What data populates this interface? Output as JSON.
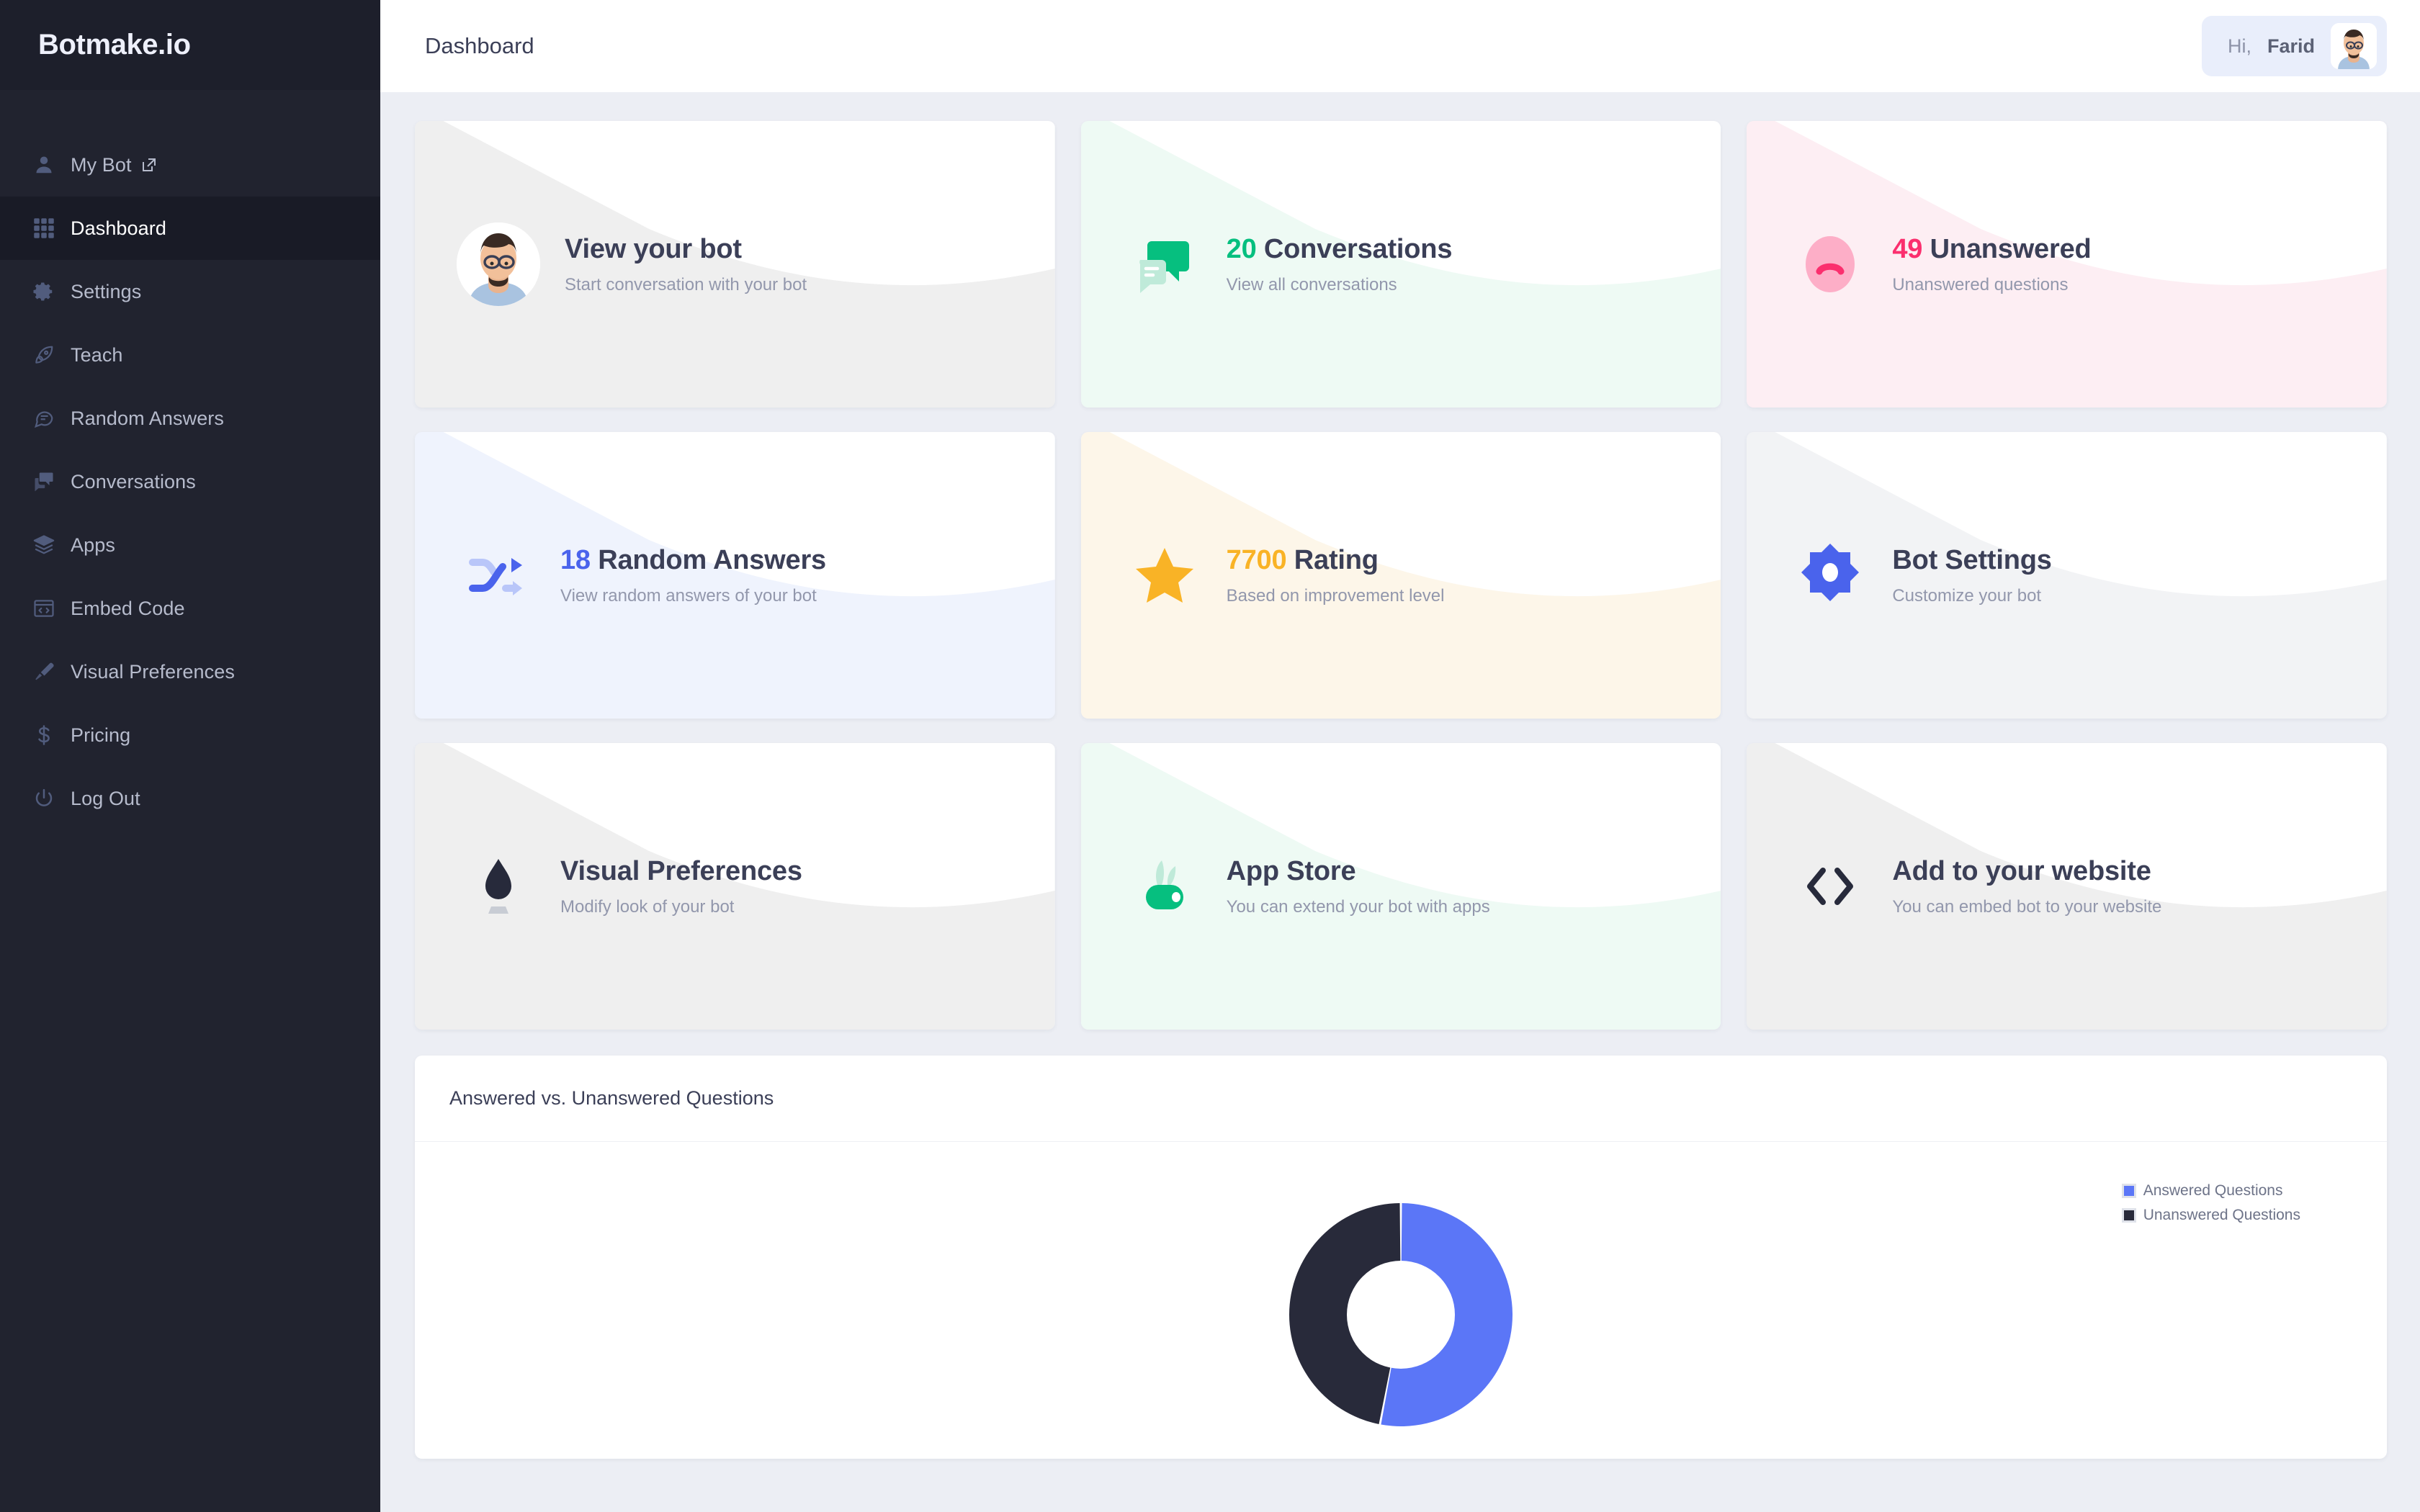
{
  "brand": {
    "name": "Botmake.io"
  },
  "sidebar": {
    "items": [
      {
        "label": "My Bot",
        "icon": "user-icon",
        "external": true,
        "active": false
      },
      {
        "label": "Dashboard",
        "icon": "grid-icon",
        "external": false,
        "active": true
      },
      {
        "label": "Settings",
        "icon": "gear-icon",
        "external": false,
        "active": false
      },
      {
        "label": "Teach",
        "icon": "rocket-icon",
        "external": false,
        "active": false
      },
      {
        "label": "Random Answers",
        "icon": "chat-bubble-lines-icon",
        "external": false,
        "active": false
      },
      {
        "label": "Conversations",
        "icon": "chat-bubbles-icon",
        "external": false,
        "active": false
      },
      {
        "label": "Apps",
        "icon": "layers-icon",
        "external": false,
        "active": false
      },
      {
        "label": "Embed Code",
        "icon": "code-window-icon",
        "external": false,
        "active": false
      },
      {
        "label": "Visual Preferences",
        "icon": "paint-brush-icon",
        "external": false,
        "active": false
      },
      {
        "label": "Pricing",
        "icon": "dollar-icon",
        "external": false,
        "active": false
      },
      {
        "label": "Log Out",
        "icon": "power-icon",
        "external": false,
        "active": false
      }
    ]
  },
  "header": {
    "title": "Dashboard",
    "greeting": "Hi,",
    "user_name": "Farid",
    "avatar_icon": "user-avatar"
  },
  "cards": [
    {
      "id": "view-your-bot",
      "number": "",
      "title": "View your bot",
      "subtitle": "Start conversation with your bot",
      "icon": "bot-avatar-icon",
      "tint": "#efefef",
      "number_color": "#3b3f57"
    },
    {
      "id": "conversations",
      "number": "20",
      "title": "Conversations",
      "subtitle": "View all conversations",
      "icon": "chat-bubbles-icon",
      "tint": "#eefaf4",
      "number_color": "#0bbd7f"
    },
    {
      "id": "unanswered",
      "number": "49",
      "title": "Unanswered",
      "subtitle": "Unanswered questions",
      "icon": "sad-face-icon",
      "tint": "#fdeef3",
      "number_color": "#f8२"
    },
    {
      "id": "random-answers",
      "number": "18",
      "title": "Random Answers",
      "subtitle": "View random answers of your bot",
      "icon": "shuffle-icon",
      "tint": "#eff3fd",
      "number_color": "#4a63ec"
    },
    {
      "id": "rating",
      "number": "7700",
      "title": "Rating",
      "subtitle": "Based on improvement level",
      "icon": "star-icon",
      "tint": "#fdf6e9",
      "number_color": "#f9b326"
    },
    {
      "id": "bot-settings",
      "number": "",
      "title": "Bot Settings",
      "subtitle": "Customize your bot",
      "icon": "settings-flower-icon",
      "tint": "#f2f3f5",
      "number_color": "#3b3f57"
    },
    {
      "id": "visual-preferences",
      "number": "",
      "title": "Visual Preferences",
      "subtitle": "Modify look of your bot",
      "icon": "ink-drop-icon",
      "tint": "#efefef",
      "number_color": "#3b3f57"
    },
    {
      "id": "app-store",
      "number": "",
      "title": "App Store",
      "subtitle": "You can extend your bot with apps",
      "icon": "seedling-icon",
      "tint": "#eefaf4",
      "number_color": "#3b3f57"
    },
    {
      "id": "add-to-website",
      "number": "",
      "title": "Add to your website",
      "subtitle": "You can embed bot to your website",
      "icon": "code-brackets-icon",
      "tint": "#efefef",
      "number_color": "#3b3f57"
    }
  ],
  "chart_panel": {
    "title": "Answered vs. Unanswered Questions"
  },
  "chart_data": {
    "type": "pie",
    "variant": "donut",
    "title": "Answered vs. Unanswered Questions",
    "categories": [
      "Answered Questions",
      "Unanswered Questions"
    ],
    "values": [
      53,
      47
    ],
    "colors": [
      "#5b76f7",
      "#282a3a"
    ],
    "legend_position": "right",
    "start_angle_deg": 0,
    "direction": "clockwise",
    "inner_radius_ratio": 0.52
  },
  "colors": {
    "page_bg": "#eceef4",
    "sidebar_bg": "#21232f",
    "sidebar_active_bg": "#191b26",
    "accent_blue": "#5b76f7",
    "accent_green": "#0bbd7f",
    "accent_pink": "#fb3b6d",
    "accent_yellow": "#f9b326",
    "text_dark": "#3b3f57",
    "text_muted": "#9297ac"
  }
}
